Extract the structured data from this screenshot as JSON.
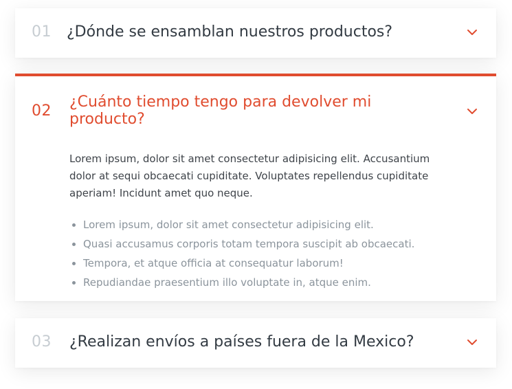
{
  "colors": {
    "accent": "#e04c2f",
    "question_text": "#333b43",
    "muted_number": "#c7cdd2",
    "body_text": "#3e4349",
    "list_text": "#8b949c"
  },
  "faq": {
    "items": [
      {
        "number": "01",
        "question": "¿Dónde se ensamblan nuestros productos?",
        "expanded": false,
        "toggle_icon": "chevron-down-icon"
      },
      {
        "number": "02",
        "question": "¿Cuánto tiempo tengo para devolver mi producto?",
        "expanded": true,
        "toggle_icon": "chevron-down-icon",
        "answer": {
          "paragraph": "Lorem ipsum, dolor sit amet consectetur adipisicing elit. Accusantium dolor at sequi obcaecati cupiditate. Voluptates repellendus cupiditate aperiam! Incidunt amet quo neque.",
          "list": [
            "Lorem ipsum, dolor sit amet consectetur adipisicing elit.",
            "Quasi accusamus corporis totam tempora suscipit ab obcaecati.",
            "Tempora, et atque officia at consequatur laborum!",
            "Repudiandae praesentium illo voluptate in, atque enim."
          ]
        }
      },
      {
        "number": "03",
        "question": "¿Realizan envíos a países fuera de la Mexico?",
        "expanded": false,
        "toggle_icon": "chevron-down-icon"
      }
    ]
  }
}
